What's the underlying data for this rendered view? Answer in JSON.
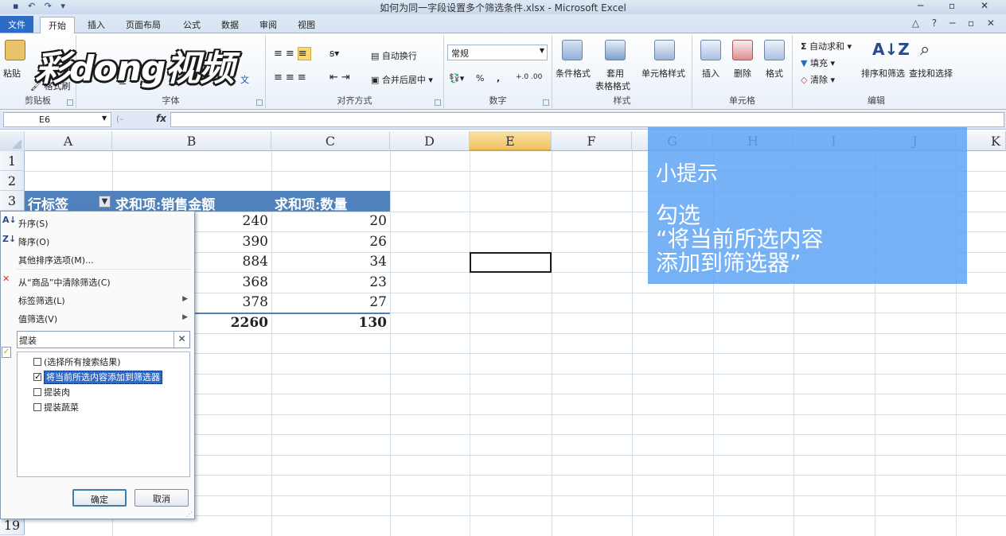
{
  "titlebar": {
    "title": "如何为同一字段设置多个筛选条件.xlsx - Microsoft Excel",
    "qat": "▪ ↶ ↷ ▾",
    "window_controls": "─ ▫ ✕"
  },
  "tabs": [
    {
      "label": "文件"
    },
    {
      "label": "开始"
    },
    {
      "label": "插入"
    },
    {
      "label": "页面布局"
    },
    {
      "label": "公式"
    },
    {
      "label": "数据"
    },
    {
      "label": "审阅"
    },
    {
      "label": "视图"
    }
  ],
  "tabs_right": "△ ? ─ ▫ ✕",
  "watermark": "彩dong视频",
  "ribbon": {
    "clipboard": {
      "paste": "粘贴",
      "format_painter": "格式刷",
      "title": "剪贴板"
    },
    "font": {
      "title": "字体",
      "bold": "B",
      "italic": "I",
      "underline": "U"
    },
    "alignment": {
      "wrap": "自动换行",
      "merge": "合并后居中",
      "title": "对齐方式"
    },
    "number": {
      "format": "常规",
      "percent": "%",
      "comma": ",",
      "title": "数字"
    },
    "styles": {
      "conditional": "条件格式",
      "table_line1": "套用",
      "table_line2": "表格格式",
      "cell_styles": "单元格样式",
      "title": "样式"
    },
    "cells": {
      "insert": "插入",
      "delete": "删除",
      "format": "格式",
      "title": "单元格"
    },
    "editing": {
      "autosum": "自动求和",
      "fill": "填充",
      "clear": "清除",
      "sort_filter": "排序和筛选",
      "find_select": "查找和选择",
      "title": "编辑"
    }
  },
  "formula_bar": {
    "name_box": "E6",
    "fx": "fx",
    "value": ""
  },
  "columns": [
    "A",
    "B",
    "C",
    "D",
    "E",
    "F",
    "G",
    "H",
    "I",
    "J",
    "K"
  ],
  "rows": [
    "1",
    "2",
    "3",
    "19"
  ],
  "pivot": {
    "header_a": "行标签",
    "header_b": "求和项:销售金额",
    "header_c": "求和项:数量",
    "values_b": [
      "240",
      "390",
      "884",
      "368",
      "378"
    ],
    "values_c": [
      "20",
      "26",
      "34",
      "23",
      "27"
    ],
    "total_b": "2260",
    "total_c": "130"
  },
  "tip": {
    "title": "小提示",
    "body": "勾选\n“将当前所选内容\n添加到筛选器”"
  },
  "filter_menu": {
    "sort_asc": "升序(S)",
    "sort_desc": "降序(O)",
    "more_sort": "其他排序选项(M)...",
    "clear_filter": "从“商品”中清除筛选(C)",
    "label_filter": "标签筛选(L)",
    "value_filter": "值筛选(V)",
    "search_value": "提装",
    "items": [
      {
        "label": "(选择所有搜索结果)",
        "checked": false
      },
      {
        "label": "将当前所选内容添加到筛选器",
        "checked": true
      },
      {
        "label": "提装肉",
        "checked": false
      },
      {
        "label": "提装蔬菜",
        "checked": false
      }
    ],
    "ok": "确定",
    "cancel": "取消"
  }
}
